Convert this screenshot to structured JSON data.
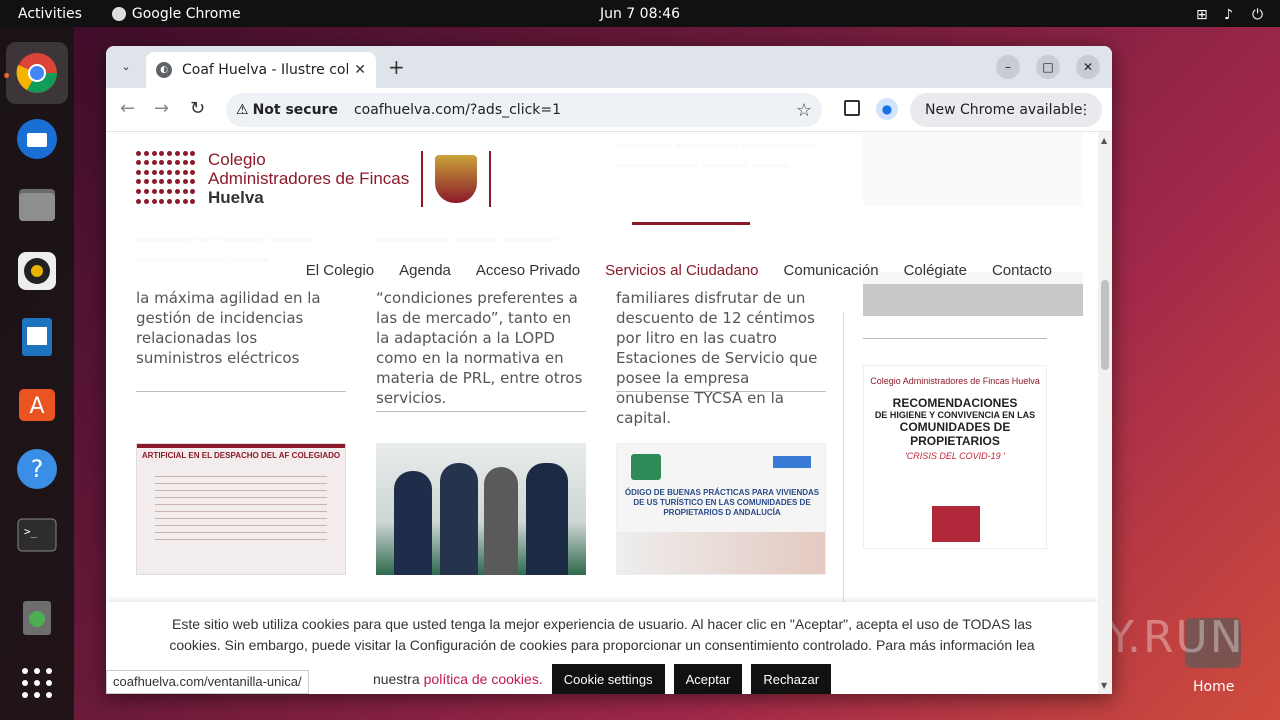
{
  "topbar": {
    "activities": "Activities",
    "app_name": "Google Chrome",
    "clock": "Jun 7  08:46"
  },
  "dock": {
    "items": [
      "chrome",
      "thunderbird",
      "files",
      "rhythmbox",
      "libreoffice-writer",
      "app-center",
      "help",
      "terminal",
      "trash",
      "show-apps"
    ]
  },
  "desktop": {
    "home_label": "Home",
    "watermark": "ANY.RUN"
  },
  "browser": {
    "tab_title": "Coaf Huelva - Ilustre cole",
    "security": "Not secure",
    "url": "coafhuelva.com/?ads_click=1",
    "update_label": "New Chrome available",
    "status_url": "coafhuelva.com/ventanilla-unica/"
  },
  "site": {
    "logo_line1": "Colegio",
    "logo_line2": "Administradores de Fincas",
    "logo_line3": "Huelva",
    "menu": [
      "El Colegio",
      "Agenda",
      "Acceso Privado",
      "Servicios al Ciudadano",
      "Comunicación",
      "Colégiate",
      "Contacto"
    ],
    "col1_text": "la máxima agilidad en la gestión de incidencias relacionadas los suministros eléctricos",
    "col2_text": "“condiciones preferentes a las de mercado”, tanto en la adaptación a la LOPD como en la normativa en materia de PRL, entre otros servicios.",
    "col3_text": "familiares disfrutar de un descuento de 12 céntimos por litro en las cuatro Estaciones de Servicio que posee la empresa onubense TYCSA en la capital.",
    "thumb1_title": "ARTIFICIAL EN EL DESPACHO DEL AF COLEGIADO",
    "thumb3_title": "ÓDIGO DE BUENAS PRÁCTICAS PARA VIVIENDAS DE US TURÍSTICO EN LAS COMUNIDADES DE PROPIETARIOS D ANDALUCÍA",
    "covid_card": {
      "header": "Colegio Administradores de Fincas Huelva",
      "line1": "RECOMENDACIONES",
      "line2": "DE HIGIENE Y CONVIVENCIA EN LAS",
      "line3": "COMUNIDADES DE PROPIETARIOS",
      "line4": "'CRISIS DEL COVID-19 '"
    }
  },
  "cookie": {
    "text1": "Este sitio web utiliza cookies para que usted tenga la mejor experiencia de usuario. Al hacer clic en \"Aceptar\", acepta el uso de TODAS las",
    "text2": "cookies. Sin embargo, puede visitar la Configuración de cookies para proporcionar un consentimiento controlado. Para más información lea",
    "text3": "nuestra",
    "link": "política de cookies.",
    "settings_btn": "Cookie settings",
    "accept_btn": "Aceptar",
    "reject_btn": "Rechazar"
  }
}
